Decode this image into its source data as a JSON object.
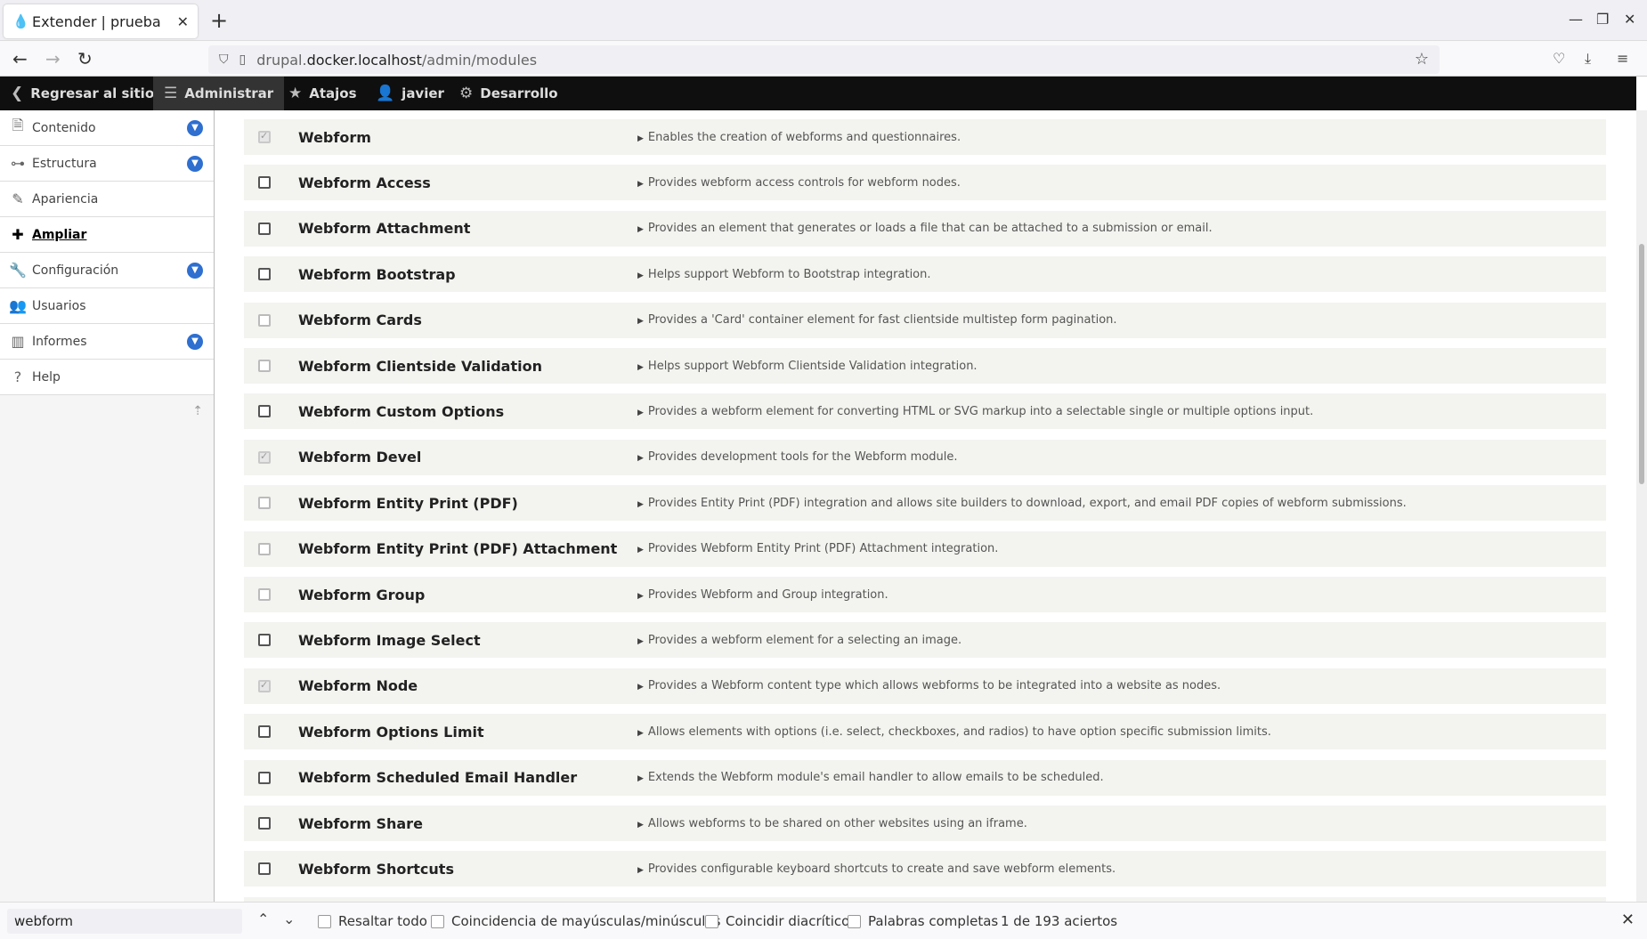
{
  "browser": {
    "tab_title": "Extender | prueba",
    "url_prefix": "drupal.",
    "url_host": "docker.localhost",
    "url_path": "/admin/modules"
  },
  "toolbar": {
    "back_to_site": "Regresar al sitio",
    "manage": "Administrar",
    "shortcuts": "Atajos",
    "user": "javier",
    "development": "Desarrollo"
  },
  "sidebar": {
    "items": [
      {
        "label": "Contenido",
        "icon": "document-icon",
        "expandable": true
      },
      {
        "label": "Estructura",
        "icon": "structure-icon",
        "expandable": true
      },
      {
        "label": "Apariencia",
        "icon": "brush-icon",
        "expandable": false
      },
      {
        "label": "Ampliar",
        "icon": "puzzle-icon",
        "expandable": false,
        "current": true
      },
      {
        "label": "Configuración",
        "icon": "wrench-icon",
        "expandable": true
      },
      {
        "label": "Usuarios",
        "icon": "users-icon",
        "expandable": false
      },
      {
        "label": "Informes",
        "icon": "chart-icon",
        "expandable": true
      },
      {
        "label": "Help",
        "icon": "help-icon",
        "expandable": false
      }
    ]
  },
  "modules": [
    {
      "name": "Webform",
      "desc": "Enables the creation of webforms and questionnaires.",
      "state": "checked"
    },
    {
      "name": "Webform Access",
      "desc": "Provides webform access controls for webform nodes.",
      "state": "unchecked"
    },
    {
      "name": "Webform Attachment",
      "desc": "Provides an element that generates or loads a file that can be attached to a submission or email.",
      "state": "unchecked"
    },
    {
      "name": "Webform Bootstrap",
      "desc": "Helps support Webform to Bootstrap integration.",
      "state": "unchecked"
    },
    {
      "name": "Webform Cards",
      "desc": "Provides a 'Card' container element for fast clientside multistep form pagination.",
      "state": "disabled"
    },
    {
      "name": "Webform Clientside Validation",
      "desc": "Helps support Webform Clientside Validation integration.",
      "state": "disabled"
    },
    {
      "name": "Webform Custom Options",
      "desc": "Provides a webform element for converting HTML or SVG markup into a selectable single or multiple options input.",
      "state": "unchecked"
    },
    {
      "name": "Webform Devel",
      "desc": "Provides development tools for the Webform module.",
      "state": "checked"
    },
    {
      "name": "Webform Entity Print (PDF)",
      "desc": "Provides Entity Print (PDF) integration and allows site builders to download, export, and email PDF copies of webform submissions.",
      "state": "disabled"
    },
    {
      "name": "Webform Entity Print (PDF) Attachment",
      "desc": "Provides Webform Entity Print (PDF) Attachment integration.",
      "state": "disabled"
    },
    {
      "name": "Webform Group",
      "desc": "Provides Webform and Group integration.",
      "state": "disabled"
    },
    {
      "name": "Webform Image Select",
      "desc": "Provides a webform element for a selecting an image.",
      "state": "unchecked"
    },
    {
      "name": "Webform Node",
      "desc": "Provides a Webform content type which allows webforms to be integrated into a website as nodes.",
      "state": "checked"
    },
    {
      "name": "Webform Options Limit",
      "desc": "Allows elements with options (i.e. select, checkboxes, and radios) to have option specific submission limits.",
      "state": "unchecked"
    },
    {
      "name": "Webform Scheduled Email Handler",
      "desc": "Extends the Webform module's email handler to allow emails to be scheduled.",
      "state": "unchecked"
    },
    {
      "name": "Webform Share",
      "desc": "Allows webforms to be shared on other websites using an iframe.",
      "state": "unchecked"
    },
    {
      "name": "Webform Shortcuts",
      "desc": "Provides configurable keyboard shortcuts to create and save webform elements.",
      "state": "unchecked"
    }
  ],
  "findbar": {
    "query": "webform",
    "highlight_all": "Resaltar todo",
    "match_case": "Coincidencia de mayúsculas/minúsculas",
    "match_diacritics": "Coincidir diacríticos",
    "whole_words": "Palabras completas",
    "count": "1 de 193 aciertos"
  }
}
